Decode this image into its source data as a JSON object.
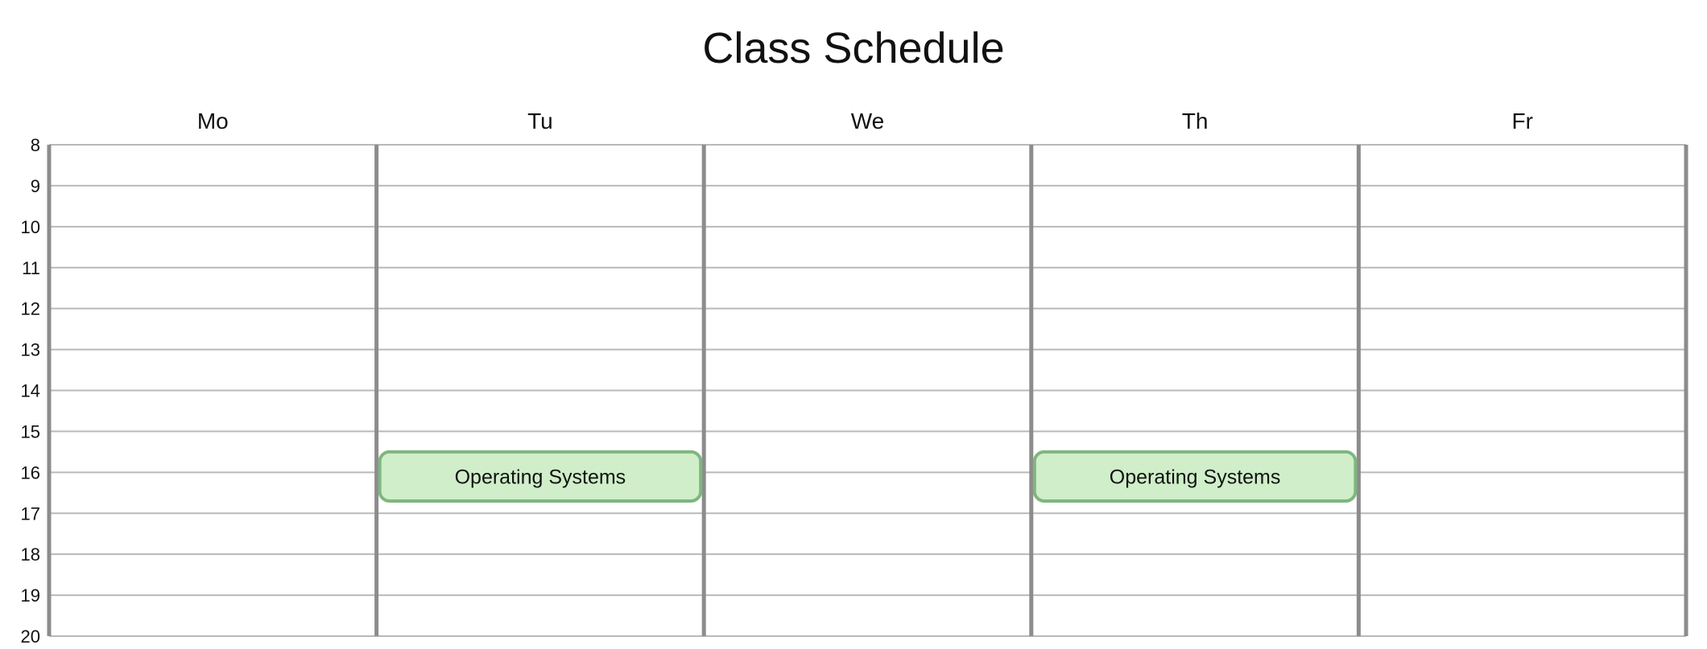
{
  "chart_data": {
    "type": "table",
    "title": "Class Schedule",
    "days": [
      "Mo",
      "Tu",
      "We",
      "Th",
      "Fr"
    ],
    "hours": [
      8,
      9,
      10,
      11,
      12,
      13,
      14,
      15,
      16,
      17,
      18,
      19,
      20
    ],
    "ylim": [
      8,
      20
    ],
    "grid": true,
    "events": [
      {
        "day": "Tu",
        "start": 15.5,
        "end": 16.7,
        "label": "Operating Systems",
        "fill": "#cfeec9",
        "stroke": "#7fb67e"
      },
      {
        "day": "Th",
        "start": 15.5,
        "end": 16.7,
        "label": "Operating Systems",
        "fill": "#cfeec9",
        "stroke": "#7fb67e"
      }
    ]
  },
  "colors": {
    "day_separator": "#8c8c8c",
    "hour_line": "#b9b9b9",
    "text": "#111111"
  }
}
